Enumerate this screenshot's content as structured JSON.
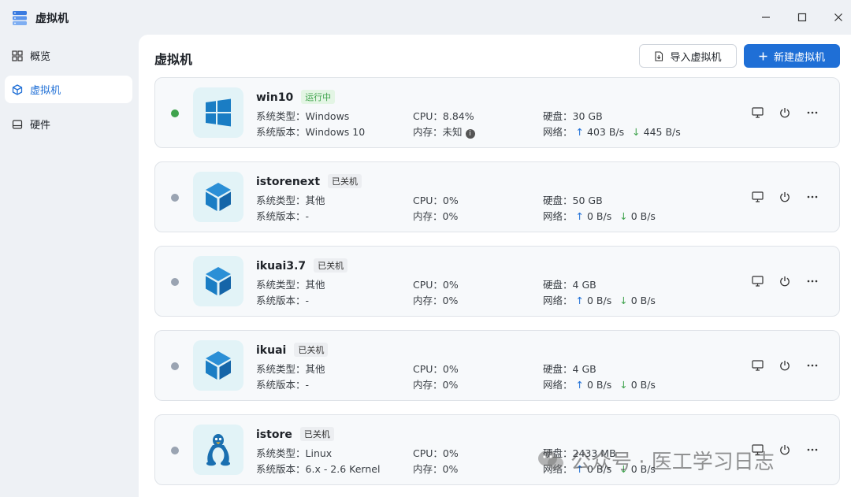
{
  "window": {
    "title": "虚拟机"
  },
  "sidebar": {
    "items": [
      {
        "label": "概览"
      },
      {
        "label": "虚拟机"
      },
      {
        "label": "硬件"
      }
    ]
  },
  "main": {
    "title": "虚拟机",
    "import_label": "导入虚拟机",
    "new_label": "新建虚拟机"
  },
  "labels": {
    "os_type": "系统类型：",
    "os_version": "系统版本：",
    "cpu": "CPU：",
    "memory": "内存：",
    "disk": "硬盘：",
    "network": "网络："
  },
  "vms": [
    {
      "name": "win10",
      "status": "运行中",
      "os_type": "Windows",
      "os_version": "Windows 10",
      "cpu": "8.84%",
      "memory": "未知",
      "disk": "30 GB",
      "up": "403 B/s",
      "down": "445 B/s"
    },
    {
      "name": "istorenext",
      "status": "已关机",
      "os_type": "其他",
      "os_version": "-",
      "cpu": "0%",
      "memory": "0%",
      "disk": "50 GB",
      "up": "0 B/s",
      "down": "0 B/s"
    },
    {
      "name": "ikuai3.7",
      "status": "已关机",
      "os_type": "其他",
      "os_version": "-",
      "cpu": "0%",
      "memory": "0%",
      "disk": "4 GB",
      "up": "0 B/s",
      "down": "0 B/s"
    },
    {
      "name": "ikuai",
      "status": "已关机",
      "os_type": "其他",
      "os_version": "-",
      "cpu": "0%",
      "memory": "0%",
      "disk": "4 GB",
      "up": "0 B/s",
      "down": "0 B/s"
    },
    {
      "name": "istore",
      "status": "已关机",
      "os_type": "Linux",
      "os_version": "6.x - 2.6 Kernel",
      "cpu": "0%",
      "memory": "0%",
      "disk": "2433 MB",
      "up": "0 B/s",
      "down": "0 B/s"
    }
  ],
  "watermark": "公众号 · 医工学习日志",
  "colors": {
    "accent": "#1f6fd6",
    "running": "#3fa34d",
    "off": "#9aa4b2",
    "icon_blue": "#1a7dc4"
  }
}
